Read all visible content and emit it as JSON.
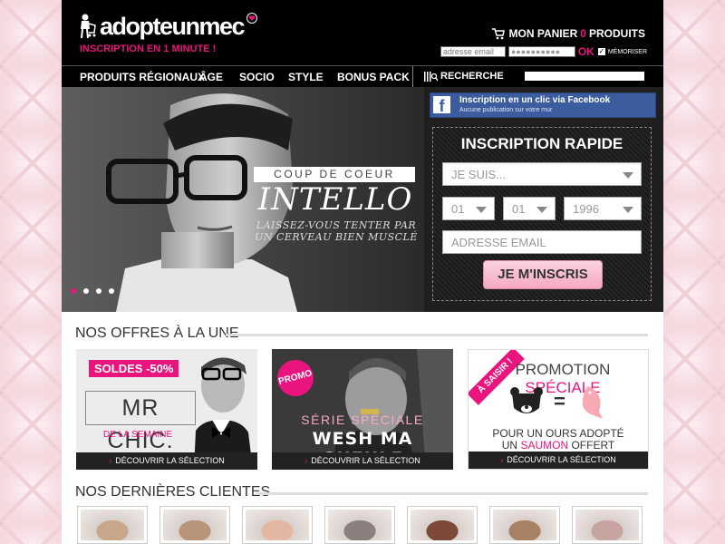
{
  "header": {
    "logo_text": "adopteunmec",
    "tagline": "INSCRIPTION EN 1 MINUTE !",
    "cart": {
      "prefix": "MON PANIER",
      "count": "0",
      "suffix": "PRODUITS"
    },
    "login": {
      "email_placeholder": "adresse email",
      "password_value": "●●●●●●●●●●",
      "submit": "OK",
      "remember": "MÉMORISER"
    }
  },
  "nav": {
    "items": [
      "PRODUITS RÉGIONAUX",
      "ÂGE",
      "SOCIO",
      "STYLE",
      "BONUS PACK"
    ],
    "search_label": "RECHERCHE"
  },
  "hero": {
    "badge": "COUP DE COEUR",
    "title": "INTELLO",
    "subtitle_line1": "LAISSEZ-VOUS TENTER PAR",
    "subtitle_line2": "UN CERVEAU BIEN MUSCLÉ",
    "slides": 4,
    "active_slide": 1
  },
  "facebook": {
    "line1": "Inscription en un clic via Facebook",
    "line2": "Aucune publication sur votre mur"
  },
  "signup": {
    "title": "INSCRIPTION RAPIDE",
    "gender": "JE SUIS...",
    "day": "01",
    "month": "01",
    "year": "1996",
    "email_placeholder": "ADRESSE EMAIL",
    "submit": "JE M'INSCRIS"
  },
  "offers": {
    "title": "NOS OFFRES À LA UNE",
    "cards": [
      {
        "badge": "SOLDES -50%",
        "title": "MR CHIC.",
        "subtitle": "DE LA SEMAINE",
        "cta": "DÉCOUVRIR LA SÉLECTION"
      },
      {
        "badge": "PROMO",
        "title": "SÉRIE SPÉCIALE",
        "subtitle": "WESH MA GUEULE",
        "cta": "DÉCOUVRIR LA SÉLECTION"
      },
      {
        "ribbon": "À SAISIR !",
        "title_a": "PROMOTION",
        "title_b": "SPÉCIALE",
        "line1": "POUR UN OURS ADOPTÉ",
        "line2_a": "UN",
        "line2_b": "SAUMON",
        "line2_c": "OFFERT",
        "cta": "DÉCOUVRIR LA SÉLECTION"
      }
    ]
  },
  "clients": {
    "title": "NOS DERNIÈRES CLIENTES",
    "thumb_colors": [
      "#c9a58a",
      "#b89478",
      "#e3b7a2",
      "#8a7f7c",
      "#7d4a3a",
      "#a88063",
      "#c7a4a0"
    ]
  },
  "colors": {
    "accent": "#e9147d",
    "facebook": "#3b5c9e",
    "button_pink": "#f5a9c0"
  }
}
